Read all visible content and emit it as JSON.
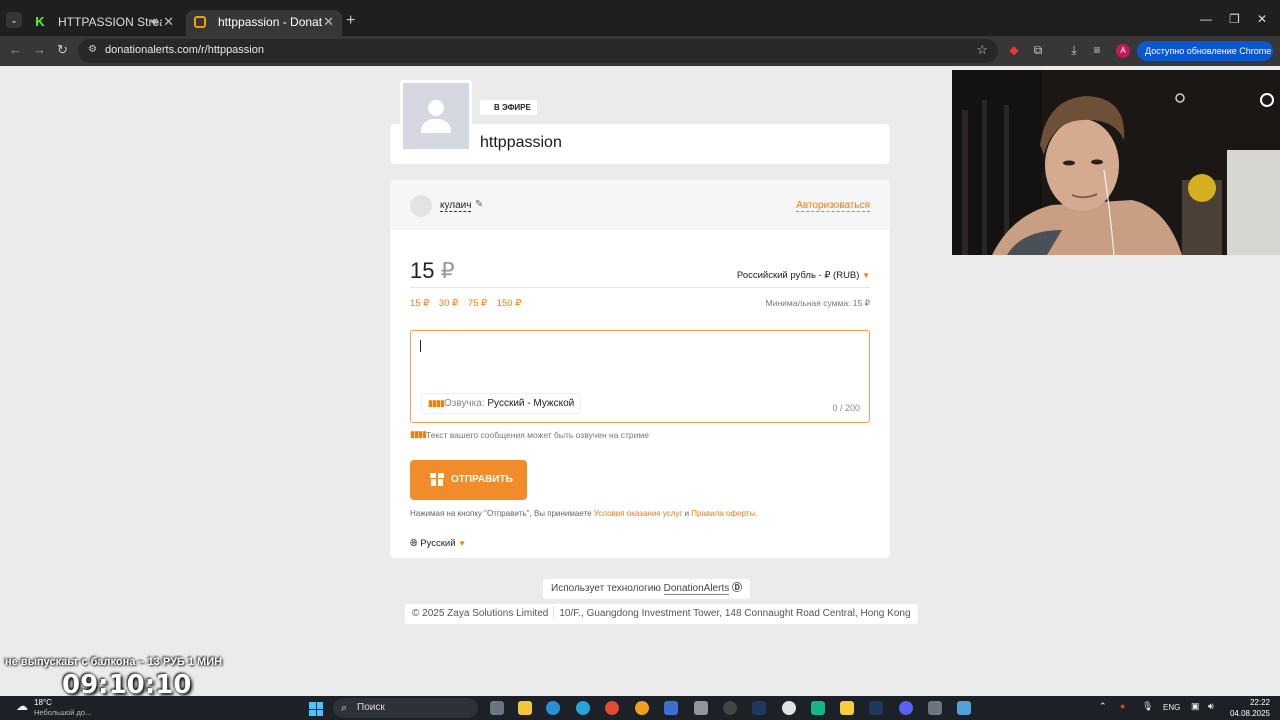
{
  "browser": {
    "tabs": [
      {
        "title": "HTTPASSION Stream - Watch",
        "favicon": "kick-favicon"
      },
      {
        "title": "httppassion - DonationAlerts",
        "favicon": "donationalerts-favicon"
      }
    ],
    "url": "donationalerts.com/r/httppassion",
    "update_label": "Доступно обновление Chrome",
    "profile_letter": "A"
  },
  "profile": {
    "live_badge": "В ЭФИРЕ",
    "streamer": "httppassion"
  },
  "donation": {
    "username": "кулаич",
    "login_link": "Авторизоваться",
    "amount": "15",
    "currency_symbol": "₽",
    "currency_select": "Российский рубль - ₽ (RUB)",
    "presets": [
      "15 ₽",
      "30 ₽",
      "75 ₽",
      "150 ₽"
    ],
    "min_sum": "Минимальная сумма: 15 ₽",
    "message_value": "",
    "voice_label": "Озвучка:",
    "voice_value": "Русский - Мужской",
    "char_counter": "0 / 200",
    "voice_hint": "Текст вашего сообщения может быть озвучен на стриме",
    "send_label": "ОТПРАВИТЬ",
    "terms_prefix": "Нажимая на кнопку \"Отправить\", Вы принимаете",
    "terms_link1": "Условия оказания услуг",
    "terms_and": "и",
    "terms_link2": "Правила оферты.",
    "language": "Русский"
  },
  "footer": {
    "powered_prefix": "Использует технологию",
    "powered_brand": "DonationAlerts",
    "copyright": "© 2025 Zaya Solutions Limited",
    "address": "10/F., Guangdong Investment Tower, 148 Connaught Road Central, Hong Kong"
  },
  "overlay": {
    "ticker": "не выпускаьт с балкона – 13 РУБ 1 МИН",
    "timer": "09:10:10"
  },
  "taskbar": {
    "temperature": "18°C",
    "weather": "Небольшой до...",
    "search_label": "Поиск",
    "language": "ENG",
    "time": "22:22",
    "date": "04.08.2025"
  },
  "colors": {
    "accent": "#f57d07",
    "send_button": "#f28c2a",
    "chrome_update": "#0b57d0"
  }
}
